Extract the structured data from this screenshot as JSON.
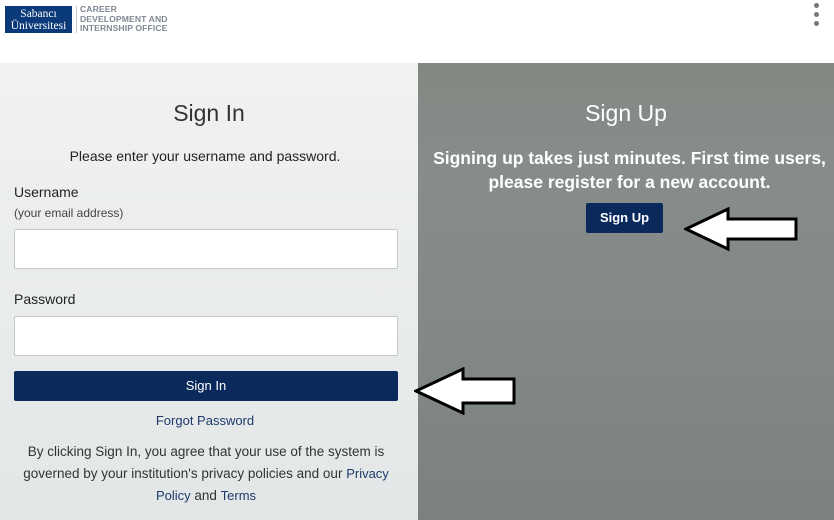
{
  "header": {
    "logo_line1": "Sabancı",
    "logo_line2": "Üniversitesi",
    "office_line1": "CAREER",
    "office_line2": "DEVELOPMENT AND",
    "office_line3": "INTERNSHIP OFFICE",
    "menu_icon": "kebab-menu-icon"
  },
  "signin": {
    "title": "Sign In",
    "instruction": "Please enter your username and password.",
    "username_label": "Username",
    "username_hint": "(your email address)",
    "username_value": "",
    "password_label": "Password",
    "password_value": "",
    "button_label": "Sign In",
    "forgot_label": "Forgot Password",
    "terms_prefix": "By clicking Sign In, you agree that your use of the system is governed by your institution's privacy policies and our ",
    "privacy_link": "Privacy Policy",
    "terms_and": " and ",
    "terms_link": "Terms"
  },
  "signup": {
    "title": "Sign Up",
    "text": "Signing up takes just minutes. First time users, please register for a new account.",
    "button_label": "Sign Up"
  },
  "colors": {
    "brand_navy": "#0b2a5c",
    "logo_blue": "#0b3a7a",
    "right_panel": "#7f8583"
  },
  "annotations": {
    "arrow_icon": "left-arrow-icon"
  }
}
